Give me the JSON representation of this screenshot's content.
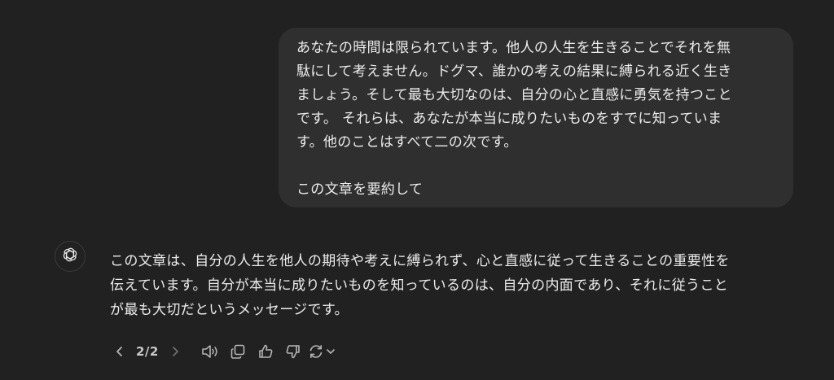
{
  "user_message": {
    "lines": [
      "あなたの時間は限られています。他人の人生を生きることでそれを無",
      "駄にして考えません。ドグマ、誰かの考えの結果に縛られる近く生き",
      "ましょう。そして最も大切なのは、自分の心と直感に勇気を持つこと",
      "です。 それらは、あなたが本当に成りたいものをすでに知っていま",
      "す。他のことはすべて二の次です。",
      "",
      "この文章を要約して"
    ]
  },
  "assistant_message": {
    "lines": [
      "この文章は、自分の人生を他人の期待や考えに縛られず、心と直感に従って生きることの重要性を",
      "伝えています。自分が本当に成りたいものを知っているのは、自分の内面であり、それに従うこと",
      "が最も大切だというメッセージです。"
    ]
  },
  "response_actions": {
    "pager": "2/2",
    "icons": [
      "chevron-left-icon",
      "chevron-right-icon",
      "speaker-icon",
      "copy-icon",
      "thumbs-up-icon",
      "thumbs-down-icon",
      "regenerate-icon",
      "chevron-down-icon"
    ]
  },
  "colors": {
    "background": "#212121",
    "user_bubble": "#2f2f2f",
    "text": "#ececec",
    "icon": "#b4b4b4"
  }
}
